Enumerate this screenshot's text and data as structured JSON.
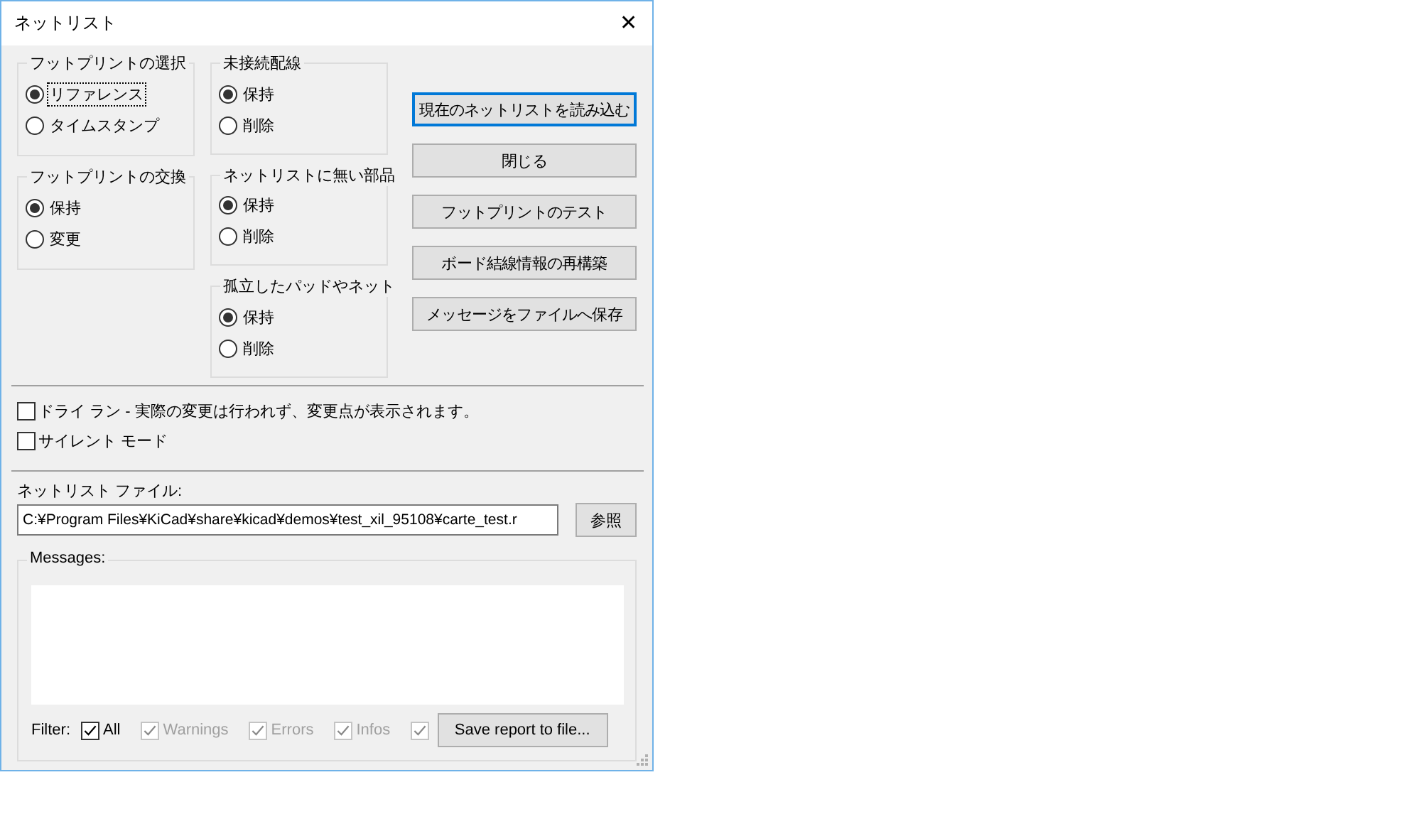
{
  "window": {
    "title": "ネットリスト",
    "close": "✕"
  },
  "left_groups": [
    {
      "title": "フットプリントの選択",
      "options": [
        {
          "label": "リファレンス",
          "selected": true,
          "focused": true
        },
        {
          "label": "タイムスタンプ",
          "selected": false,
          "focused": false
        }
      ]
    },
    {
      "title": "フットプリントの交換",
      "options": [
        {
          "label": "保持",
          "selected": true,
          "focused": false
        },
        {
          "label": "変更",
          "selected": false,
          "focused": false
        }
      ]
    }
  ],
  "middle_groups": [
    {
      "title": "未接続配線",
      "options": [
        {
          "label": "保持",
          "selected": true,
          "focused": false
        },
        {
          "label": "削除",
          "selected": false,
          "focused": false
        }
      ]
    },
    {
      "title": "ネットリストに無い部品",
      "options": [
        {
          "label": "保持",
          "selected": true,
          "focused": false
        },
        {
          "label": "削除",
          "selected": false,
          "focused": false
        }
      ]
    },
    {
      "title": "孤立したパッドやネット",
      "options": [
        {
          "label": "保持",
          "selected": true,
          "focused": false
        },
        {
          "label": "削除",
          "selected": false,
          "focused": false
        }
      ]
    }
  ],
  "buttons": [
    {
      "label": "現在のネットリストを読み込む",
      "focused": true
    },
    {
      "label": "閉じる",
      "focused": false
    },
    {
      "label": "フットプリントのテスト",
      "focused": false
    },
    {
      "label": "ボード結線情報の再構築",
      "focused": false
    },
    {
      "label": "メッセージをファイルへ保存",
      "focused": false
    }
  ],
  "checkboxes": [
    {
      "label": "ドライ ラン - 実際の変更は行われず、変更点が表示されます。",
      "checked": false
    },
    {
      "label": "サイレント モード",
      "checked": false
    }
  ],
  "netlist_file": {
    "label": "ネットリスト ファイル:",
    "value": "C:¥Program Files¥KiCad¥share¥kicad¥demos¥test_xil_95108¥carte_test.r",
    "browse": "参照"
  },
  "messages": {
    "title": "Messages:",
    "filter_label": "Filter:",
    "filters": [
      {
        "label": "All",
        "checked": true,
        "disabled": false
      },
      {
        "label": "Warnings",
        "checked": true,
        "disabled": true
      },
      {
        "label": "Errors",
        "checked": true,
        "disabled": true
      },
      {
        "label": "Infos",
        "checked": true,
        "disabled": true
      },
      {
        "checked": true,
        "disabled": true
      }
    ],
    "save_button": "Save report to file..."
  }
}
